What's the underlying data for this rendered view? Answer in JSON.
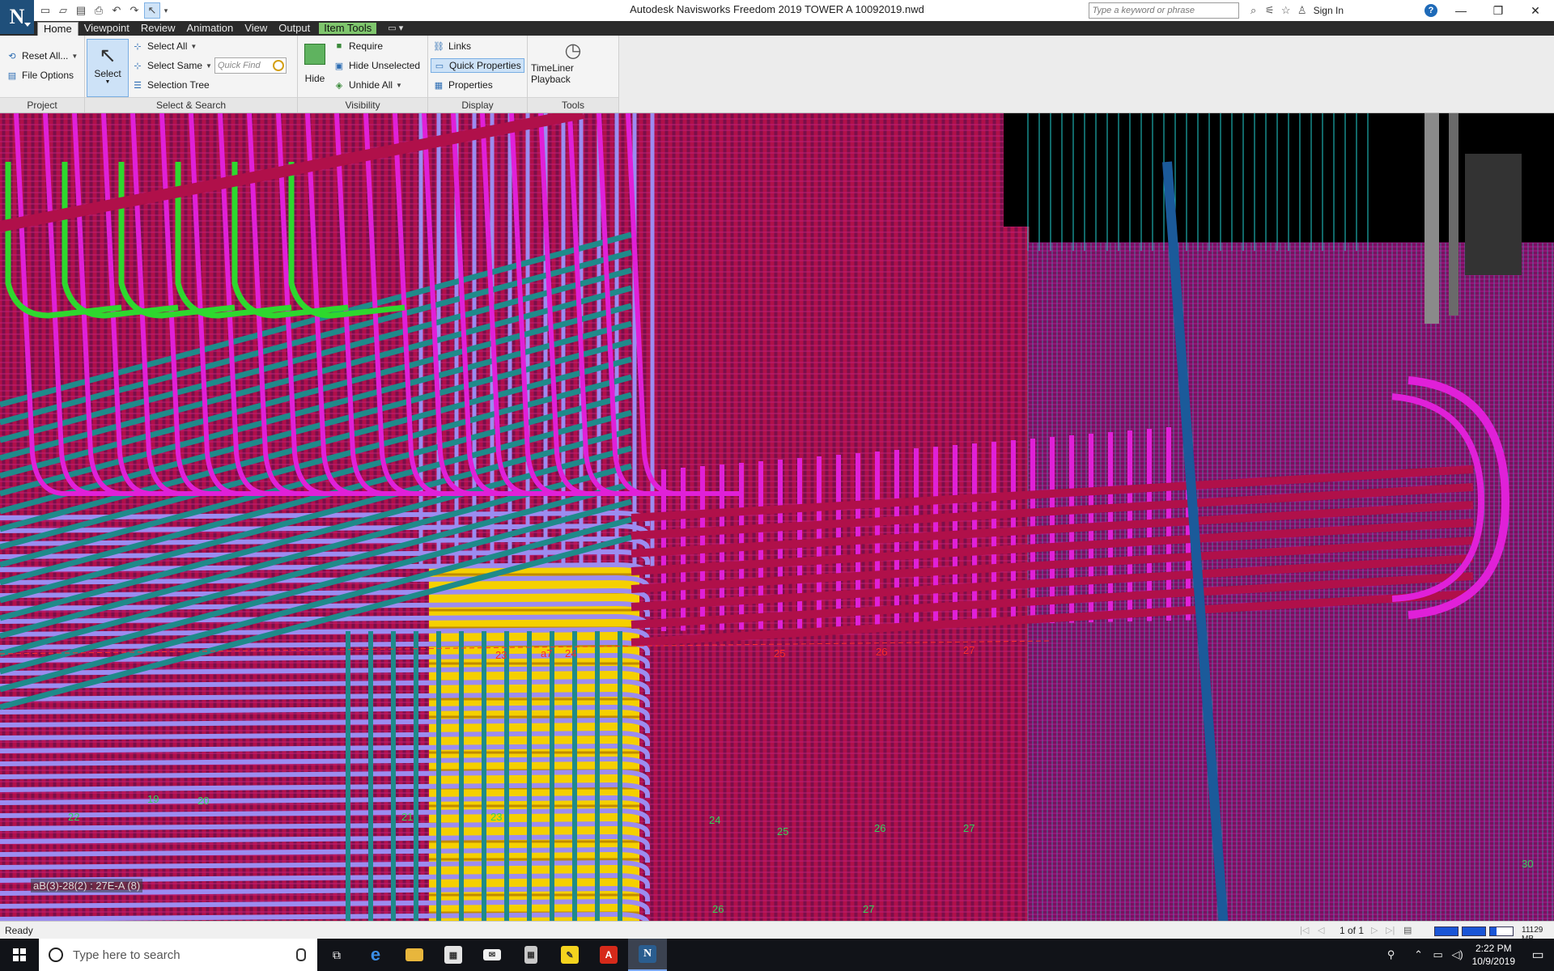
{
  "window": {
    "logo_letter": "N",
    "title": "Autodesk Navisworks Freedom 2019    TOWER A 10092019.nwd",
    "search_placeholder": "Type a keyword or phrase",
    "sign_in": "Sign In",
    "help": "?"
  },
  "ribbon": {
    "tabs": [
      "Home",
      "Viewpoint",
      "Review",
      "Animation",
      "View",
      "Output"
    ],
    "contextual_tab": "Item Tools",
    "panels": {
      "project": {
        "title": "Project",
        "reset_all": "Reset All...",
        "file_options": "File Options"
      },
      "select_search": {
        "title": "Select & Search",
        "select": "Select",
        "select_all": "Select All",
        "select_same": "Select Same",
        "selection_tree": "Selection Tree",
        "quick_find_placeholder": "Quick Find"
      },
      "visibility": {
        "title": "Visibility",
        "hide": "Hide",
        "require": "Require",
        "hide_unselected": "Hide Unselected",
        "unhide_all": "Unhide All"
      },
      "display": {
        "title": "Display",
        "links": "Links",
        "quick_properties": "Quick Properties",
        "properties": "Properties"
      },
      "tools": {
        "title": "Tools",
        "timeliner_playback": "TimeLiner Playback"
      }
    }
  },
  "viewport": {
    "tooltip": "aB(3)-28(2) : 27E-A (8)",
    "gridline_labels_red": [
      "23",
      "a7",
      "24",
      "25",
      "26",
      "27"
    ],
    "gridline_labels_green": [
      "22",
      "19",
      "20",
      "21",
      "23",
      "24",
      "25",
      "26",
      "27",
      "28",
      "29",
      "30"
    ]
  },
  "status": {
    "text": "Ready",
    "page": "1 of 1",
    "memory": "11129 MB"
  },
  "taskbar": {
    "search_placeholder": "Type here to search",
    "time": "2:22 PM",
    "date": "10/9/2019"
  },
  "colors": {
    "rebar_magenta": "#e020d8",
    "rebar_crimson": "#b0104a",
    "rebar_lavender": "#9c8cf0",
    "rebar_teal": "#1f8a8a",
    "rebar_green": "#2ed82e",
    "column_yellow": "#f5d000",
    "mesh_cyan": "#22d0d0",
    "pipe_blue": "#1b5a9a"
  }
}
